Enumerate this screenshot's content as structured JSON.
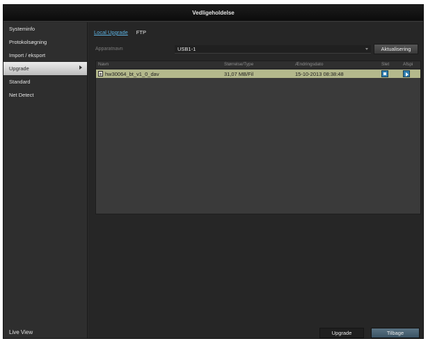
{
  "window": {
    "title": "Vedligeholdelse"
  },
  "sidebar": {
    "items": [
      {
        "label": "Systeminfo",
        "active": false
      },
      {
        "label": "Protokolsøgning",
        "active": false
      },
      {
        "label": "Import / eksport",
        "active": false
      },
      {
        "label": "Upgrade",
        "active": true
      },
      {
        "label": "Standard",
        "active": false
      },
      {
        "label": "Net Detect",
        "active": false
      }
    ],
    "live_view": "Live View"
  },
  "tabs": [
    {
      "label": "Local Upgrade",
      "active": true
    },
    {
      "label": "FTP",
      "active": false
    }
  ],
  "device": {
    "label": "Apparatnavn",
    "value": "USB1-1",
    "refresh_label": "Aktualisering"
  },
  "table": {
    "columns": [
      "Navn",
      "Størrelse/Type",
      "Ændringsdato",
      "Slet",
      "Afspi"
    ],
    "rows": [
      {
        "name": "hw30064_bt_v1_0_dav",
        "size": "31,07 MB/Fil",
        "date": "15-10-2013 08:38:48",
        "delete_icon": "delete-icon",
        "play_icon": "play-icon"
      }
    ]
  },
  "buttons": {
    "upgrade": "Upgrade",
    "back": "Tilbage"
  },
  "colors": {
    "accent_tab": "#5db3e3",
    "selected_row": "#b4b98c",
    "action_button": "#2f7fb0"
  }
}
